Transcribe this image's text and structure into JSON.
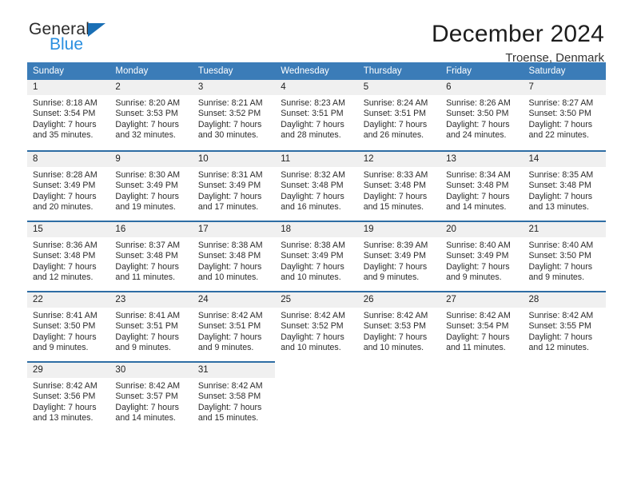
{
  "brand": {
    "name_top": "General",
    "name_bottom": "Blue",
    "mark": "triangle-logo"
  },
  "header": {
    "title": "December 2024",
    "location": "Troense, Denmark"
  },
  "calendar": {
    "weekday_headers": [
      "Sunday",
      "Monday",
      "Tuesday",
      "Wednesday",
      "Thursday",
      "Friday",
      "Saturday"
    ],
    "colors": {
      "header_blue": "#3b7cb8",
      "rule_blue": "#2e6da4",
      "daynum_band": "#f0f0f0",
      "brand_blue": "#2a8fe0",
      "brand_mark_blue": "#1a6fb5"
    },
    "weeks": [
      [
        {
          "day": "1",
          "sunrise": "Sunrise: 8:18 AM",
          "sunset": "Sunset: 3:54 PM",
          "daylight1": "Daylight: 7 hours",
          "daylight2": "and 35 minutes."
        },
        {
          "day": "2",
          "sunrise": "Sunrise: 8:20 AM",
          "sunset": "Sunset: 3:53 PM",
          "daylight1": "Daylight: 7 hours",
          "daylight2": "and 32 minutes."
        },
        {
          "day": "3",
          "sunrise": "Sunrise: 8:21 AM",
          "sunset": "Sunset: 3:52 PM",
          "daylight1": "Daylight: 7 hours",
          "daylight2": "and 30 minutes."
        },
        {
          "day": "4",
          "sunrise": "Sunrise: 8:23 AM",
          "sunset": "Sunset: 3:51 PM",
          "daylight1": "Daylight: 7 hours",
          "daylight2": "and 28 minutes."
        },
        {
          "day": "5",
          "sunrise": "Sunrise: 8:24 AM",
          "sunset": "Sunset: 3:51 PM",
          "daylight1": "Daylight: 7 hours",
          "daylight2": "and 26 minutes."
        },
        {
          "day": "6",
          "sunrise": "Sunrise: 8:26 AM",
          "sunset": "Sunset: 3:50 PM",
          "daylight1": "Daylight: 7 hours",
          "daylight2": "and 24 minutes."
        },
        {
          "day": "7",
          "sunrise": "Sunrise: 8:27 AM",
          "sunset": "Sunset: 3:50 PM",
          "daylight1": "Daylight: 7 hours",
          "daylight2": "and 22 minutes."
        }
      ],
      [
        {
          "day": "8",
          "sunrise": "Sunrise: 8:28 AM",
          "sunset": "Sunset: 3:49 PM",
          "daylight1": "Daylight: 7 hours",
          "daylight2": "and 20 minutes."
        },
        {
          "day": "9",
          "sunrise": "Sunrise: 8:30 AM",
          "sunset": "Sunset: 3:49 PM",
          "daylight1": "Daylight: 7 hours",
          "daylight2": "and 19 minutes."
        },
        {
          "day": "10",
          "sunrise": "Sunrise: 8:31 AM",
          "sunset": "Sunset: 3:49 PM",
          "daylight1": "Daylight: 7 hours",
          "daylight2": "and 17 minutes."
        },
        {
          "day": "11",
          "sunrise": "Sunrise: 8:32 AM",
          "sunset": "Sunset: 3:48 PM",
          "daylight1": "Daylight: 7 hours",
          "daylight2": "and 16 minutes."
        },
        {
          "day": "12",
          "sunrise": "Sunrise: 8:33 AM",
          "sunset": "Sunset: 3:48 PM",
          "daylight1": "Daylight: 7 hours",
          "daylight2": "and 15 minutes."
        },
        {
          "day": "13",
          "sunrise": "Sunrise: 8:34 AM",
          "sunset": "Sunset: 3:48 PM",
          "daylight1": "Daylight: 7 hours",
          "daylight2": "and 14 minutes."
        },
        {
          "day": "14",
          "sunrise": "Sunrise: 8:35 AM",
          "sunset": "Sunset: 3:48 PM",
          "daylight1": "Daylight: 7 hours",
          "daylight2": "and 13 minutes."
        }
      ],
      [
        {
          "day": "15",
          "sunrise": "Sunrise: 8:36 AM",
          "sunset": "Sunset: 3:48 PM",
          "daylight1": "Daylight: 7 hours",
          "daylight2": "and 12 minutes."
        },
        {
          "day": "16",
          "sunrise": "Sunrise: 8:37 AM",
          "sunset": "Sunset: 3:48 PM",
          "daylight1": "Daylight: 7 hours",
          "daylight2": "and 11 minutes."
        },
        {
          "day": "17",
          "sunrise": "Sunrise: 8:38 AM",
          "sunset": "Sunset: 3:48 PM",
          "daylight1": "Daylight: 7 hours",
          "daylight2": "and 10 minutes."
        },
        {
          "day": "18",
          "sunrise": "Sunrise: 8:38 AM",
          "sunset": "Sunset: 3:49 PM",
          "daylight1": "Daylight: 7 hours",
          "daylight2": "and 10 minutes."
        },
        {
          "day": "19",
          "sunrise": "Sunrise: 8:39 AM",
          "sunset": "Sunset: 3:49 PM",
          "daylight1": "Daylight: 7 hours",
          "daylight2": "and 9 minutes."
        },
        {
          "day": "20",
          "sunrise": "Sunrise: 8:40 AM",
          "sunset": "Sunset: 3:49 PM",
          "daylight1": "Daylight: 7 hours",
          "daylight2": "and 9 minutes."
        },
        {
          "day": "21",
          "sunrise": "Sunrise: 8:40 AM",
          "sunset": "Sunset: 3:50 PM",
          "daylight1": "Daylight: 7 hours",
          "daylight2": "and 9 minutes."
        }
      ],
      [
        {
          "day": "22",
          "sunrise": "Sunrise: 8:41 AM",
          "sunset": "Sunset: 3:50 PM",
          "daylight1": "Daylight: 7 hours",
          "daylight2": "and 9 minutes."
        },
        {
          "day": "23",
          "sunrise": "Sunrise: 8:41 AM",
          "sunset": "Sunset: 3:51 PM",
          "daylight1": "Daylight: 7 hours",
          "daylight2": "and 9 minutes."
        },
        {
          "day": "24",
          "sunrise": "Sunrise: 8:42 AM",
          "sunset": "Sunset: 3:51 PM",
          "daylight1": "Daylight: 7 hours",
          "daylight2": "and 9 minutes."
        },
        {
          "day": "25",
          "sunrise": "Sunrise: 8:42 AM",
          "sunset": "Sunset: 3:52 PM",
          "daylight1": "Daylight: 7 hours",
          "daylight2": "and 10 minutes."
        },
        {
          "day": "26",
          "sunrise": "Sunrise: 8:42 AM",
          "sunset": "Sunset: 3:53 PM",
          "daylight1": "Daylight: 7 hours",
          "daylight2": "and 10 minutes."
        },
        {
          "day": "27",
          "sunrise": "Sunrise: 8:42 AM",
          "sunset": "Sunset: 3:54 PM",
          "daylight1": "Daylight: 7 hours",
          "daylight2": "and 11 minutes."
        },
        {
          "day": "28",
          "sunrise": "Sunrise: 8:42 AM",
          "sunset": "Sunset: 3:55 PM",
          "daylight1": "Daylight: 7 hours",
          "daylight2": "and 12 minutes."
        }
      ],
      [
        {
          "day": "29",
          "sunrise": "Sunrise: 8:42 AM",
          "sunset": "Sunset: 3:56 PM",
          "daylight1": "Daylight: 7 hours",
          "daylight2": "and 13 minutes."
        },
        {
          "day": "30",
          "sunrise": "Sunrise: 8:42 AM",
          "sunset": "Sunset: 3:57 PM",
          "daylight1": "Daylight: 7 hours",
          "daylight2": "and 14 minutes."
        },
        {
          "day": "31",
          "sunrise": "Sunrise: 8:42 AM",
          "sunset": "Sunset: 3:58 PM",
          "daylight1": "Daylight: 7 hours",
          "daylight2": "and 15 minutes."
        },
        {
          "day": "",
          "sunrise": "",
          "sunset": "",
          "daylight1": "",
          "daylight2": ""
        },
        {
          "day": "",
          "sunrise": "",
          "sunset": "",
          "daylight1": "",
          "daylight2": ""
        },
        {
          "day": "",
          "sunrise": "",
          "sunset": "",
          "daylight1": "",
          "daylight2": ""
        },
        {
          "day": "",
          "sunrise": "",
          "sunset": "",
          "daylight1": "",
          "daylight2": ""
        }
      ]
    ]
  }
}
